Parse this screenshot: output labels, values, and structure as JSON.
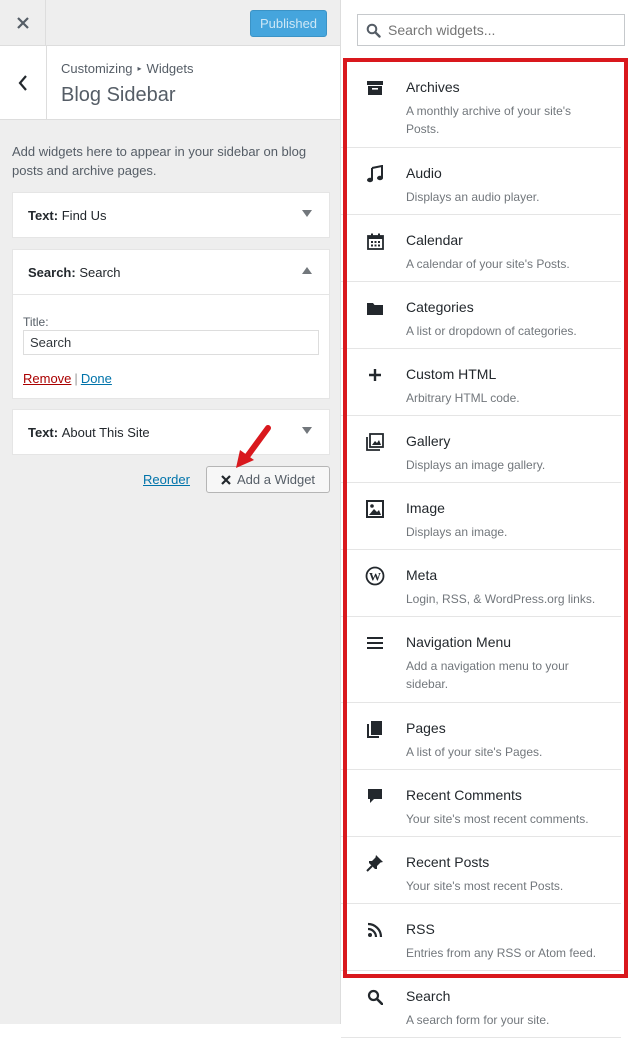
{
  "topbar": {
    "publish_label": "Published"
  },
  "header": {
    "breadcrumb_parent": "Customizing",
    "breadcrumb_current": "Widgets",
    "title": "Blog Sidebar"
  },
  "sidebar_description": "Add widgets here to appear in your sidebar on blog posts and archive pages.",
  "widgets": [
    {
      "type": "Text:",
      "title": "Find Us"
    },
    {
      "type": "Search:",
      "title": "Search",
      "form": {
        "title_label": "Title:",
        "title_value": "Search",
        "remove_label": "Remove",
        "separator": "|",
        "done_label": "Done"
      }
    },
    {
      "type": "Text:",
      "title": "About This Site"
    }
  ],
  "actions": {
    "reorder_label": "Reorder",
    "add_widget_label": "Add a Widget"
  },
  "search": {
    "placeholder": "Search widgets..."
  },
  "available_widgets": [
    {
      "icon": "archive-icon",
      "title": "Archives",
      "desc": "A monthly archive of your site's Posts."
    },
    {
      "icon": "music-note-icon",
      "title": "Audio",
      "desc": "Displays an audio player."
    },
    {
      "icon": "calendar-icon",
      "title": "Calendar",
      "desc": "A calendar of your site's Posts."
    },
    {
      "icon": "folder-icon",
      "title": "Categories",
      "desc": "A list or dropdown of categories."
    },
    {
      "icon": "plus-icon",
      "title": "Custom HTML",
      "desc": "Arbitrary HTML code."
    },
    {
      "icon": "gallery-icon",
      "title": "Gallery",
      "desc": "Displays an image gallery."
    },
    {
      "icon": "image-icon",
      "title": "Image",
      "desc": "Displays an image."
    },
    {
      "icon": "wordpress-icon",
      "title": "Meta",
      "desc": "Login, RSS, & WordPress.org links."
    },
    {
      "icon": "menu-icon",
      "title": "Navigation Menu",
      "desc": "Add a navigation menu to your sidebar."
    },
    {
      "icon": "pages-icon",
      "title": "Pages",
      "desc": "A list of your site's Pages."
    },
    {
      "icon": "comment-icon",
      "title": "Recent Comments",
      "desc": "Your site's most recent comments."
    },
    {
      "icon": "pin-icon",
      "title": "Recent Posts",
      "desc": "Your site's most recent Posts."
    },
    {
      "icon": "rss-icon",
      "title": "RSS",
      "desc": "Entries from any RSS or Atom feed."
    },
    {
      "icon": "search-icon",
      "title": "Search",
      "desc": "A search form for your site."
    }
  ],
  "colors": {
    "accent": "#0073aa",
    "publish": "#45a5dd",
    "highlight_border": "#d9181d",
    "annotation_arrow": "#d9181d",
    "remove_link": "#aa0000"
  }
}
